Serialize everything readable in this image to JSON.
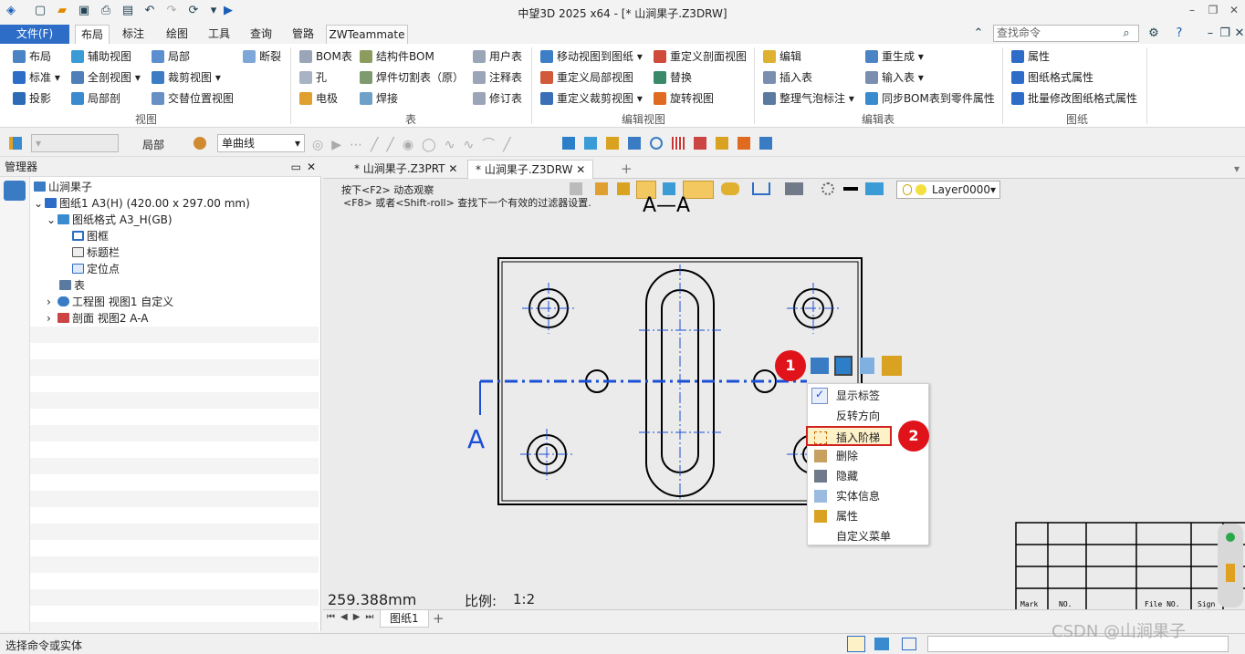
{
  "window": {
    "title": "中望3D 2025 x64 - [* 山涧果子.Z3DRW]"
  },
  "tabs": {
    "file": "文件(F)",
    "items": [
      "布局",
      "标注",
      "绘图",
      "工具",
      "查询",
      "管路"
    ],
    "active": "布局",
    "zw": "ZWTeammate"
  },
  "search": {
    "placeholder": "查找命令"
  },
  "ribbon": {
    "view": {
      "label": "视图",
      "items": [
        "布局",
        "辅助视图",
        "局部",
        "断裂",
        "标准",
        "全剖视图",
        "裁剪视图",
        "投影",
        "局部剖",
        "交替位置视图"
      ]
    },
    "table": {
      "label": "表",
      "items": [
        "BOM表",
        "结构件BOM",
        "用户表",
        "孔",
        "焊件切割表（原）",
        "注释表",
        "电极",
        "焊接",
        "修订表"
      ]
    },
    "editview": {
      "label": "编辑视图",
      "items": [
        "移动视图到图纸",
        "重定义剖面视图",
        "重定义局部视图",
        "替换",
        "重定义裁剪视图",
        "旋转视图"
      ]
    },
    "edittable": {
      "label": "编辑表",
      "items": [
        "编辑",
        "重生成",
        "插入表",
        "输入表",
        "整理气泡标注",
        "同步BOM表到零件属性"
      ]
    },
    "drawing": {
      "label": "图纸",
      "items": [
        "属性",
        "图纸格式属性",
        "批量修改图纸格式属性"
      ]
    }
  },
  "toolbar2": {
    "mode": "局部",
    "linetype": "单曲线"
  },
  "manager": {
    "title": "管理器",
    "tree": [
      {
        "label": "山涧果子"
      },
      {
        "label": "图纸1 A3(H) (420.00 x 297.00 mm)"
      },
      {
        "label": "图纸格式 A3_H(GB)"
      },
      {
        "label": "图框"
      },
      {
        "label": "标题栏"
      },
      {
        "label": "定位点"
      },
      {
        "label": "表"
      },
      {
        "label": "工程图 视图1 自定义"
      },
      {
        "label": "剖面 视图2 A-A"
      }
    ]
  },
  "doctabs": [
    "* 山涧果子.Z3PRT",
    "* 山涧果子.Z3DRW"
  ],
  "hint": {
    "line1": "按下<F2> 动态观察",
    "line2": "<F8> 或者<Shift-roll> 查找下一个有效的过滤器设置."
  },
  "layer": "Layer0000",
  "canvas": {
    "section_title": "A—A",
    "section_letter": "A",
    "coord": "259.388mm",
    "scale_label": "比例:",
    "scale_value": "1:2"
  },
  "titleblock": [
    "Mark",
    "NO.",
    "File NO.",
    "Sign"
  ],
  "contextmenu": {
    "items": [
      "显示标签",
      "反转方向",
      "插入阶梯",
      "删除",
      "隐藏",
      "实体信息",
      "属性",
      "自定义菜单"
    ]
  },
  "badges": [
    "1",
    "2"
  ],
  "sheet": "图纸1",
  "status": {
    "text": "选择命令或实体"
  },
  "watermark": "CSDN @山涧果子",
  "colors": {
    "accent": "#2d6dc8",
    "section_line": "#1a4fd6",
    "badge": "#e0131b"
  }
}
